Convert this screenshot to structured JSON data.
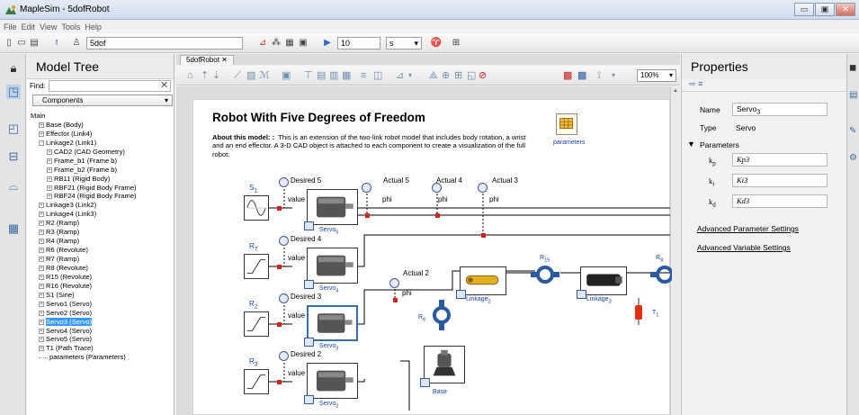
{
  "window": {
    "title": "MapleSim - 5dofRobot",
    "buttons": [
      "▭",
      "▣",
      "✕"
    ]
  },
  "menu": [
    "File",
    "Edit",
    "View",
    "Tools",
    "Help"
  ],
  "toolbar": {
    "model_name": "5dof",
    "sim_time": "10",
    "time_unit": "s"
  },
  "model_tree": {
    "header": "Model Tree",
    "find_label": "Find:",
    "filter": "Components",
    "items": [
      {
        "label": "Main",
        "indent": 0,
        "expander": ""
      },
      {
        "label": "Base (Body)",
        "indent": 1,
        "expander": "+"
      },
      {
        "label": "Effector (Link4)",
        "indent": 1,
        "expander": "+"
      },
      {
        "label": "Linkage2 (Link1)",
        "indent": 1,
        "expander": "-"
      },
      {
        "label": "CAD2 (CAD Geometry)",
        "indent": 2,
        "expander": "+"
      },
      {
        "label": "Frame_b1 (Frame b)",
        "indent": 2,
        "expander": "+"
      },
      {
        "label": "Frame_b2 (Frame b)",
        "indent": 2,
        "expander": "+"
      },
      {
        "label": "RB11 (Rigid Body)",
        "indent": 2,
        "expander": "+"
      },
      {
        "label": "RBF21 (Rigid Body Frame)",
        "indent": 2,
        "expander": "+"
      },
      {
        "label": "RBF24 (Rigid Body Frame)",
        "indent": 2,
        "expander": "+"
      },
      {
        "label": "Linkage3 (Link2)",
        "indent": 1,
        "expander": "+"
      },
      {
        "label": "Linkage4 (Link3)",
        "indent": 1,
        "expander": "+"
      },
      {
        "label": "R2 (Ramp)",
        "indent": 1,
        "expander": "+"
      },
      {
        "label": "R3 (Ramp)",
        "indent": 1,
        "expander": "+"
      },
      {
        "label": "R4 (Ramp)",
        "indent": 1,
        "expander": "+"
      },
      {
        "label": "R6 (Revolute)",
        "indent": 1,
        "expander": "+"
      },
      {
        "label": "R7 (Ramp)",
        "indent": 1,
        "expander": "+"
      },
      {
        "label": "R8 (Revolute)",
        "indent": 1,
        "expander": "+"
      },
      {
        "label": "R15 (Revolute)",
        "indent": 1,
        "expander": "+"
      },
      {
        "label": "R16 (Revolute)",
        "indent": 1,
        "expander": "+"
      },
      {
        "label": "S1 (Sine)",
        "indent": 1,
        "expander": "+"
      },
      {
        "label": "Servo1 (Servo)",
        "indent": 1,
        "expander": "+"
      },
      {
        "label": "Servo2 (Servo)",
        "indent": 1,
        "expander": "+"
      },
      {
        "label": "Servo3 (Servo)",
        "indent": 1,
        "expander": "+",
        "selected": true
      },
      {
        "label": "Servo4 (Servo)",
        "indent": 1,
        "expander": "+"
      },
      {
        "label": "Servo5 (Servo)",
        "indent": 1,
        "expander": "+"
      },
      {
        "label": "T1 (Path Trace)",
        "indent": 1,
        "expander": "+"
      },
      {
        "label": "parameters (Parameters)",
        "indent": 1,
        "expander": ""
      }
    ]
  },
  "doc_tab": {
    "label": "5dofRobot",
    "close": "✕"
  },
  "zoom": "100%",
  "diagram": {
    "title": "Robot With Five Degrees of Freedom",
    "about_bold": "About this model: :",
    "about_text": "This is an extension of the two-link robot model that includes body rotation, a wrist and an end effector.  A 3-D CAD object is attached to each component to create a visualization of the full robot.",
    "parameters_label": "parameters",
    "desired": [
      "Desired 5",
      "Desired 4",
      "Desired 3",
      "Desired 2"
    ],
    "actual": [
      "Actual 5",
      "Actual 4",
      "Actual 3",
      "Actual 2"
    ],
    "value_label": "value",
    "phi_label": "phi",
    "sources": [
      {
        "name": "S",
        "sub": "1"
      },
      {
        "name": "R",
        "sub": "7"
      },
      {
        "name": "R",
        "sub": "2"
      },
      {
        "name": "R",
        "sub": "3"
      }
    ],
    "servos": [
      {
        "name": "Servo",
        "sub": "5"
      },
      {
        "name": "Servo",
        "sub": "4"
      },
      {
        "name": "Servo",
        "sub": "3"
      },
      {
        "name": "Servo",
        "sub": "2"
      }
    ],
    "joints": [
      {
        "name": "R",
        "sub": "15"
      },
      {
        "name": "R",
        "sub": "8"
      },
      {
        "name": "R",
        "sub": "6"
      },
      {
        "name": "T",
        "sub": "1"
      }
    ],
    "links": [
      {
        "name": "Linkage",
        "sub": "2"
      },
      {
        "name": "Linkage",
        "sub": "3"
      }
    ],
    "base": "Base"
  },
  "properties": {
    "header": "Properties",
    "name_label": "Name",
    "name_value": "Servo",
    "name_sub": "3",
    "type_label": "Type",
    "type_value": "Servo",
    "parameters_label": "Parameters",
    "params": [
      {
        "symbol": "k",
        "sub": "p",
        "value": "Kp3"
      },
      {
        "symbol": "k",
        "sub": "i",
        "value": "Ki3"
      },
      {
        "symbol": "k",
        "sub": "d",
        "value": "Kd3"
      }
    ],
    "adv_params": "Advanced Parameter Settings",
    "adv_vars": "Advanced Variable Settings"
  }
}
